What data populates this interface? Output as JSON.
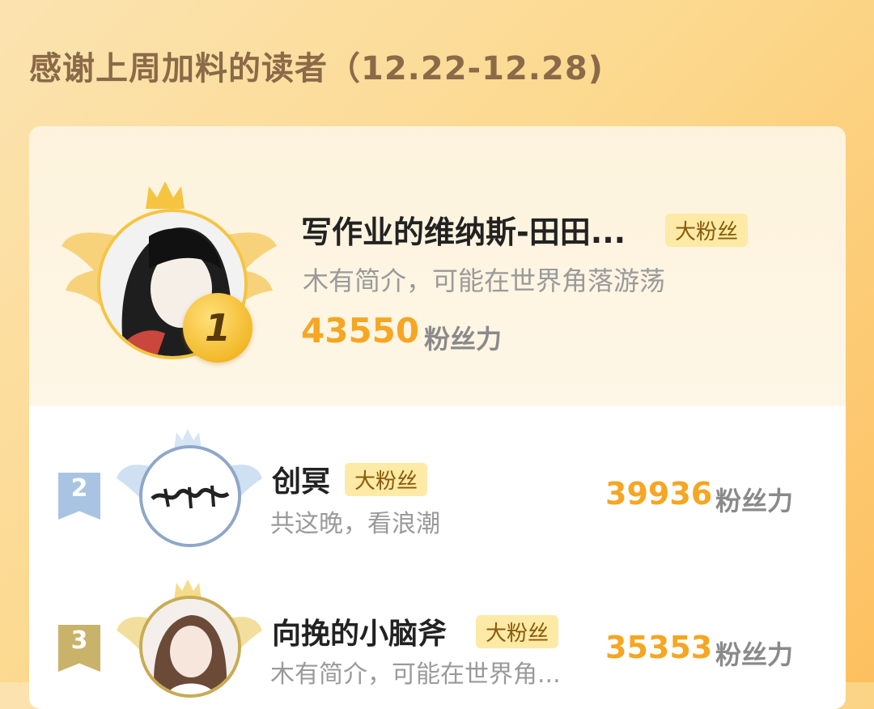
{
  "heading": "感谢上周加料的读者（12.22-12.28)",
  "colors": {
    "accent": "#f5a623",
    "tag_bg": "#fdeaa6",
    "rank2": "#a9c4e2",
    "rank3": "#c9b26a"
  },
  "top_reader": {
    "rank": "1",
    "name": "写作业的维纳斯-田田...",
    "tag": "大粉丝",
    "bio": "木有简介，可能在世界角落游荡",
    "score": "43550",
    "unit": "粉丝力"
  },
  "readers": [
    {
      "rank": "2",
      "name": "创冥",
      "tag": "大粉丝",
      "bio": "共这晚，看浪潮",
      "score": "39936",
      "unit": "粉丝力"
    },
    {
      "rank": "3",
      "name": "向挽的小脑斧",
      "tag": "大粉丝",
      "bio": "木有简介，可能在世界角...",
      "score": "35353",
      "unit": "粉丝力"
    }
  ]
}
